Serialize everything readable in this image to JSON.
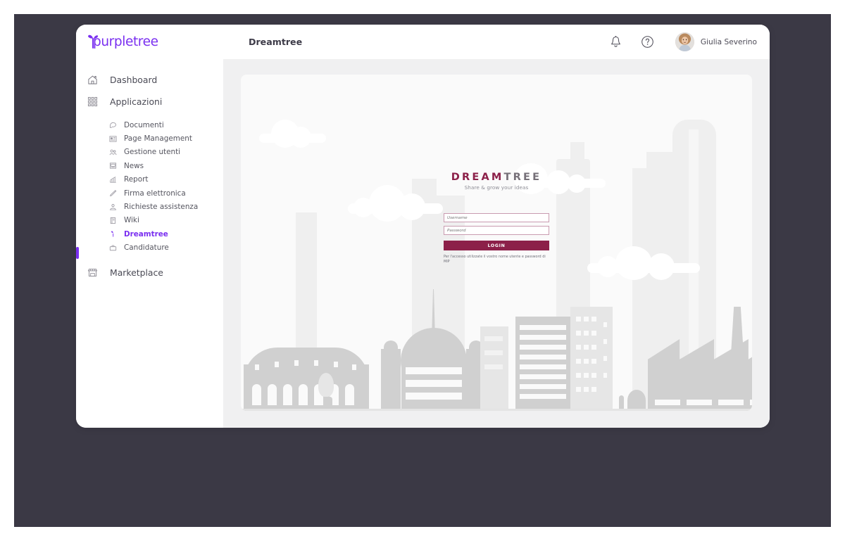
{
  "window": {
    "logo_text": "purpletree",
    "accent_color": "#7a2ff0",
    "desktop_color": "#3b3945"
  },
  "sidebar": {
    "top_items": [
      {
        "label": "Dashboard",
        "icon": "home-icon"
      },
      {
        "label": "Applicazioni",
        "icon": "grid-apps-icon"
      }
    ],
    "sub_items": [
      {
        "label": "Documenti",
        "icon": "document-icon",
        "active": false
      },
      {
        "label": "Page Management",
        "icon": "page-management-icon",
        "active": false
      },
      {
        "label": "Gestione utenti",
        "icon": "users-icon",
        "active": false
      },
      {
        "label": "News",
        "icon": "news-icon",
        "active": false
      },
      {
        "label": "Report",
        "icon": "report-chart-icon",
        "active": false
      },
      {
        "label": "Firma elettronica",
        "icon": "pen-signature-icon",
        "active": false
      },
      {
        "label": "Richieste assistenza",
        "icon": "support-person-icon",
        "active": false
      },
      {
        "label": "Wiki",
        "icon": "wiki-book-icon",
        "active": false
      },
      {
        "label": "Dreamtree",
        "icon": "dreamtree-sprout-icon",
        "active": true
      },
      {
        "label": "Candidature",
        "icon": "briefcase-icon",
        "active": false
      }
    ],
    "marketplace": {
      "label": "Marketplace",
      "icon": "storefront-icon"
    }
  },
  "topbar": {
    "page_title": "Dreamtree",
    "notification_icon": "bell-icon",
    "help_icon": "question-circle-icon",
    "user_name": "Giulia Severino",
    "avatar_icon": "avatar"
  },
  "login": {
    "brand_part1": "DREAM",
    "brand_part2": "TREE",
    "tagline": "Share & grow your ideas",
    "username_placeholder": "Username",
    "username_value": "",
    "password_placeholder": "Password",
    "password_value": "",
    "login_label": "LOGIN",
    "hint": "Per l'accesso utilizzate il vostro nome utente e password di MIP",
    "brand_color": "#8c2049",
    "brand_color_secondary": "#767078",
    "field_border_color": "#c99bb0"
  }
}
